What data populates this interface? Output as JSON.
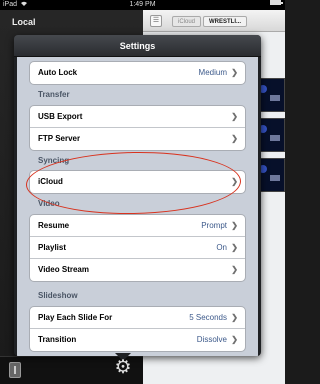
{
  "status_bar": {
    "device": "iPad",
    "time": "1:49 PM"
  },
  "sidebar": {
    "title": "Local"
  },
  "browser": {
    "crumbs": [
      "iCloud",
      "WRESTLI..."
    ]
  },
  "settings": {
    "title": "Settings",
    "top_row": {
      "label": "Auto Lock",
      "value": "Medium"
    },
    "sections": [
      {
        "title": "Transfer",
        "rows": [
          {
            "label": "USB Export",
            "value": ""
          },
          {
            "label": "FTP Server",
            "value": ""
          }
        ]
      },
      {
        "title": "Syncing",
        "rows": [
          {
            "label": "iCloud",
            "value": ""
          }
        ]
      },
      {
        "title": "Video",
        "rows": [
          {
            "label": "Resume",
            "value": "Prompt"
          },
          {
            "label": "Playlist",
            "value": "On"
          },
          {
            "label": "Video Stream",
            "value": ""
          }
        ]
      },
      {
        "title": "Slideshow",
        "rows": [
          {
            "label": "Play Each Slide For",
            "value": "5 Seconds"
          },
          {
            "label": "Transition",
            "value": "Dissolve"
          }
        ]
      }
    ]
  },
  "annotation_color": "#d8331f",
  "icons": {
    "settings": "gear-icon",
    "device": "device-icon",
    "menu": "menu-icon",
    "wifi": "wifi-icon",
    "battery": "battery-icon"
  }
}
